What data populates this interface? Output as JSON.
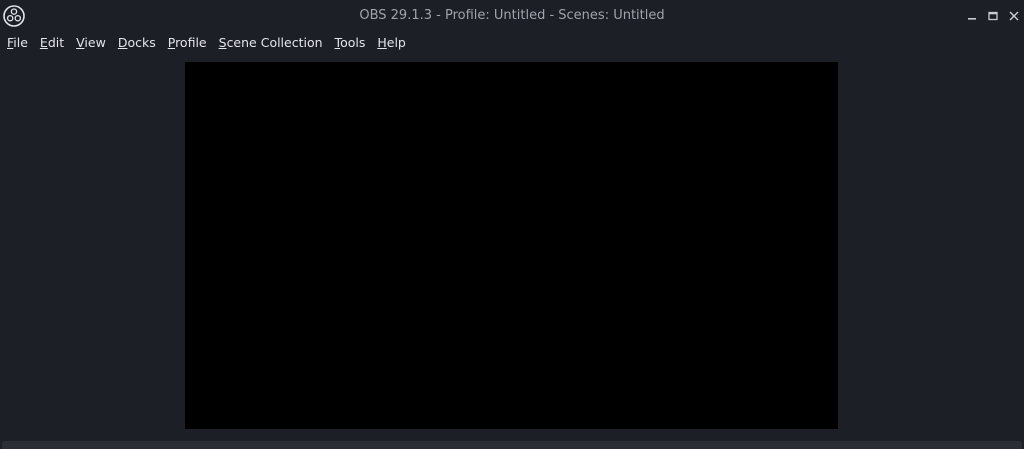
{
  "window": {
    "title": "OBS 29.1.3 - Profile: Untitled - Scenes: Untitled",
    "logo_icon": "obs-logo-icon",
    "controls": {
      "minimize_icon": "minimize-icon",
      "maximize_icon": "maximize-icon",
      "close_icon": "close-icon"
    }
  },
  "menubar": {
    "items": [
      {
        "mnemonic": "F",
        "rest": "ile"
      },
      {
        "mnemonic": "E",
        "rest": "dit"
      },
      {
        "mnemonic": "V",
        "rest": "iew"
      },
      {
        "mnemonic": "D",
        "rest": "ocks"
      },
      {
        "mnemonic": "P",
        "rest": "rofile"
      },
      {
        "mnemonic": "S",
        "rest": "cene Collection"
      },
      {
        "mnemonic": "T",
        "rest": "ools"
      },
      {
        "mnemonic": "H",
        "rest": "elp"
      }
    ]
  },
  "colors": {
    "background": "#1d1f26",
    "preview": "#000000",
    "text": "#e3e5ea",
    "title_text": "#9ea3ad"
  }
}
